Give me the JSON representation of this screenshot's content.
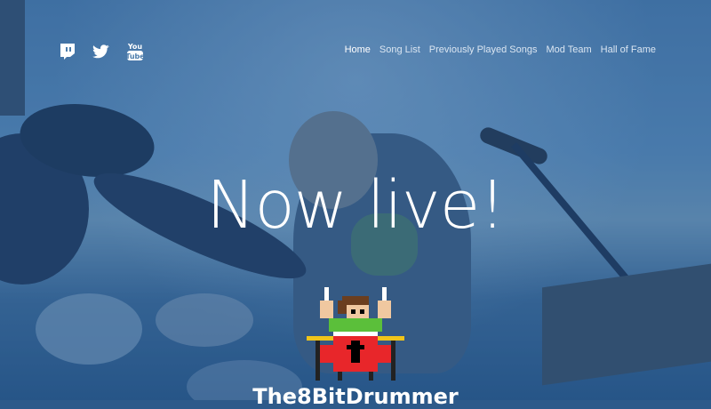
{
  "header": {
    "social_links": [
      {
        "icon": "twitch-icon",
        "label": ""
      },
      {
        "icon": "twitter-icon",
        "label": ""
      },
      {
        "icon": "youtube-icon",
        "label": "You Tube"
      }
    ],
    "nav": [
      {
        "label": "Home",
        "active": true
      },
      {
        "label": "Song List",
        "active": false
      },
      {
        "label": "Previously Played Songs",
        "active": false
      },
      {
        "label": "Mod Team",
        "active": false
      },
      {
        "label": "Hall of Fame",
        "active": false
      }
    ]
  },
  "hero": {
    "headline": "Now live!",
    "streamer_name": "The8BitDrummer",
    "mascot_icon": "pixel-drummer-icon"
  },
  "colors": {
    "text": "#ffffff",
    "nav_text": "#dbe6f2",
    "drum_red": "#e8262a",
    "cymbal_gold": "#f0c419"
  }
}
